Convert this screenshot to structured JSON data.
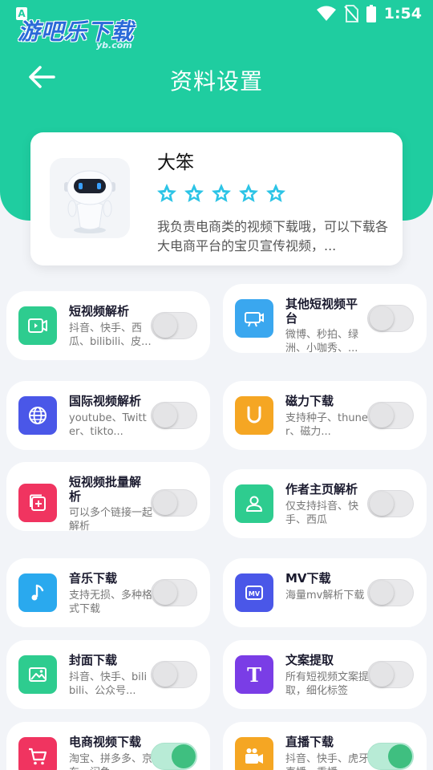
{
  "status": {
    "time": "1:54",
    "app_letter": "A"
  },
  "watermark": {
    "text": "游吧乐下载",
    "sub": "yb.com"
  },
  "header": {
    "title": "资料设置",
    "accent": "#1fcda0"
  },
  "profile": {
    "name": "大笨",
    "rating": 5,
    "description": "我负责电商类的视频下载哦，可以下载各大电商平台的宝贝宣传视频，..."
  },
  "features": [
    {
      "title": "短视频解析",
      "desc": "抖音、快手、西瓜、bilibili、皮...",
      "enabled": false,
      "color": "#2ecc8f",
      "icon": "video-camera-icon"
    },
    {
      "title": "其他短视频平台",
      "desc": "微博、秒拍、绿洲、小咖秀、...",
      "enabled": false,
      "color": "#3aa7ef",
      "icon": "vlog-camera-icon"
    },
    {
      "title": "国际视频解析",
      "desc": "youtube、Twitter、tikto...",
      "enabled": false,
      "color": "#4a57e8",
      "icon": "globe-icon"
    },
    {
      "title": "磁力下载",
      "desc": "支持种子、thuner、磁力...",
      "enabled": false,
      "color": "#f5a623",
      "icon": "magnet-icon"
    },
    {
      "title": "短视频批量解析",
      "desc": "可以多个链接一起解析",
      "enabled": false,
      "color": "#f03460",
      "icon": "batch-add-icon"
    },
    {
      "title": "作者主页解析",
      "desc": "仅支持抖音、快手、西瓜",
      "enabled": false,
      "color": "#2ecc8f",
      "icon": "user-icon"
    },
    {
      "title": "音乐下载",
      "desc": "支持无损、多种格式下载",
      "enabled": false,
      "color": "#2aa9ee",
      "icon": "music-note-icon"
    },
    {
      "title": "MV下载",
      "desc": "海量mv解析下载",
      "enabled": false,
      "color": "#4a57e8",
      "icon": "mv-icon"
    },
    {
      "title": "封面下载",
      "desc": "抖音、快手、bilibili、公众号...",
      "enabled": false,
      "color": "#2ecc8f",
      "icon": "image-icon"
    },
    {
      "title": "文案提取",
      "desc": "所有短视频文案提取，细化标签",
      "enabled": false,
      "color": "#7a3de6",
      "icon": "text-t-icon"
    },
    {
      "title": "电商视频下载",
      "desc": "淘宝、拼多多、京东、闲鱼...",
      "enabled": true,
      "color": "#f03460",
      "icon": "cart-icon"
    },
    {
      "title": "直播下载",
      "desc": "抖音、快手、虎牙直播、重播...",
      "enabled": true,
      "color": "#f5a623",
      "icon": "live-camera-icon"
    }
  ]
}
